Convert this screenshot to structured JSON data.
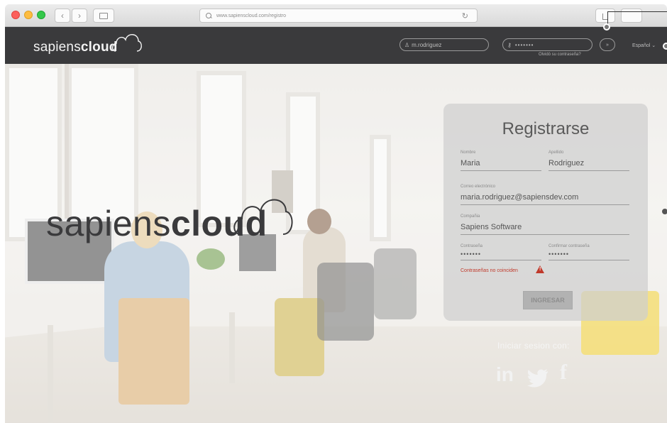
{
  "browser": {
    "url": "www.sapienscloud.com/registro"
  },
  "header": {
    "logo_light": "sapiens",
    "logo_bold": "cloud",
    "username": "m.rodriguez",
    "password_mask": "•••••••",
    "go_label": "»",
    "forgot_label": "Olvidó su contraseña?",
    "language": "Español ⌄"
  },
  "hero": {
    "logo_light": "sapiens",
    "logo_bold": "cloud"
  },
  "register_form": {
    "title": "Registrarse",
    "first_name_label": "Nombre",
    "first_name_value": "Maria",
    "last_name_label": "Apellido",
    "last_name_value": "Rodriguez",
    "email_label": "Correo electrónico",
    "email_value": "maria.rodriguez@sapiensdev.com",
    "company_label": "Compañia",
    "company_value": "Sapiens Software",
    "password_label": "Contraseña",
    "password_value": "•••••••",
    "confirm_label": "Confirmar contraseña",
    "confirm_value": "•••••••",
    "error": "Contraseñas no coinciden",
    "submit_label": "INGRESAR"
  },
  "social": {
    "title": "Iniciar sesion con:",
    "linkedin": "in",
    "facebook": "f"
  },
  "colors": {
    "header_bg": "#3a3a3c",
    "error": "#c0392b",
    "card_bg": "#cecece"
  }
}
